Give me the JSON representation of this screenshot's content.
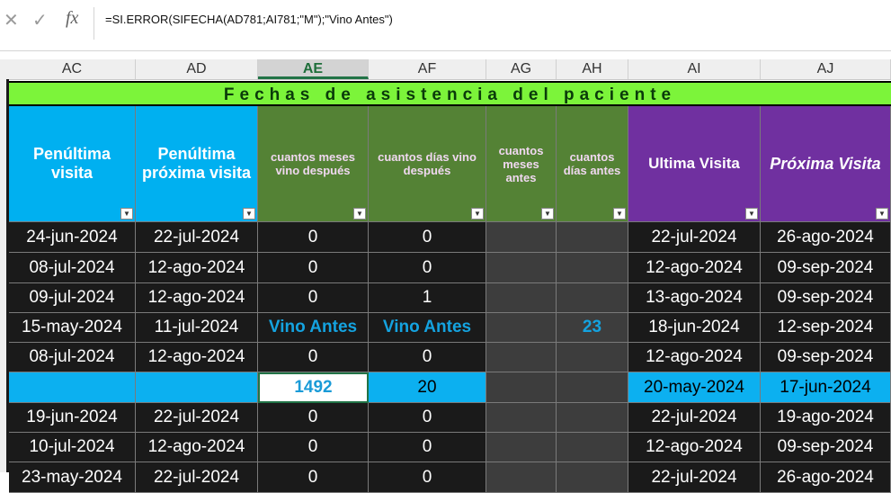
{
  "formula_bar": {
    "cancel_icon": "close-icon",
    "enter_icon": "check-icon",
    "fx_label": "fx",
    "formula": "=SI.ERROR(SIFECHA(AD781;AI781;\"M\");\"Vino Antes\")"
  },
  "columns": [
    "AC",
    "AD",
    "AE",
    "AF",
    "AG",
    "AH",
    "AI",
    "AJ"
  ],
  "selected_column": "AE",
  "banner": "Fechas de asistencia del paciente",
  "headers": [
    "Penúltima visita",
    "Penúltima próxima visita",
    "cuantos meses vino después",
    "cuantos días vino después",
    "cuantos meses antes",
    "cuantos días antes",
    "Ultima Visita",
    "Próxima Visita"
  ],
  "header_colors": {
    "blue": "#00b0f0",
    "green": "#548235",
    "purple": "#7030a0",
    "banner": "#7cfc3a"
  },
  "rows": [
    [
      "24-jun-2024",
      "22-jul-2024",
      "0",
      "0",
      "",
      "",
      "22-jul-2024",
      "26-ago-2024"
    ],
    [
      "08-jul-2024",
      "12-ago-2024",
      "0",
      "0",
      "",
      "",
      "12-ago-2024",
      "09-sep-2024"
    ],
    [
      "09-jul-2024",
      "12-ago-2024",
      "0",
      "1",
      "",
      "",
      "13-ago-2024",
      "09-sep-2024"
    ],
    [
      "15-may-2024",
      "11-jul-2024",
      "Vino Antes",
      "Vino Antes",
      "",
      "23",
      "18-jun-2024",
      "12-sep-2024"
    ],
    [
      "08-jul-2024",
      "12-ago-2024",
      "0",
      "0",
      "",
      "",
      "12-ago-2024",
      "09-sep-2024"
    ],
    [
      "",
      "",
      "1492",
      "20",
      "",
      "",
      "20-may-2024",
      "17-jun-2024"
    ],
    [
      "19-jun-2024",
      "22-jul-2024",
      "0",
      "0",
      "",
      "",
      "22-jul-2024",
      "19-ago-2024"
    ],
    [
      "10-jul-2024",
      "12-ago-2024",
      "0",
      "0",
      "",
      "",
      "12-ago-2024",
      "09-sep-2024"
    ],
    [
      "23-may-2024",
      "22-jul-2024",
      "0",
      "0",
      "",
      "",
      "22-jul-2024",
      "26-ago-2024"
    ]
  ]
}
